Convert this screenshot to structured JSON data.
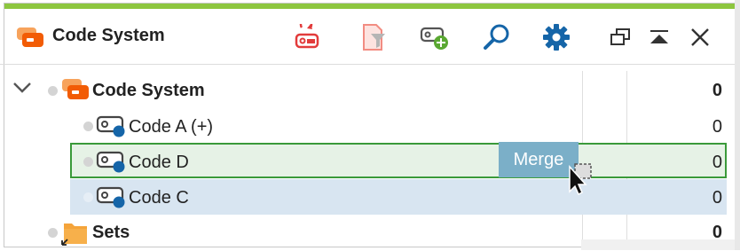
{
  "header": {
    "title": "Code System",
    "icons": [
      "code-system-icon",
      "remove-codes-icon",
      "filter-document-icon",
      "new-code-icon",
      "search-icon",
      "settings-icon",
      "undock-icon",
      "collapse-icon",
      "close-icon"
    ]
  },
  "tree": {
    "root": {
      "label": "Code System",
      "count": "0"
    },
    "items": [
      {
        "label": "Code A (+)",
        "count": "0"
      },
      {
        "label": "Code D",
        "count": "0"
      },
      {
        "label": "Code C",
        "count": "0"
      }
    ],
    "sets": {
      "label": "Sets",
      "count": "0"
    }
  },
  "drag": {
    "tooltip": "Merge"
  },
  "colors": {
    "accent_bar": "#8dc63f",
    "code_icon_orange": "#f25c05",
    "code_dot_blue": "#1565a8",
    "drop_target_border": "#3a9a3a",
    "drop_target_bg": "#e6f2e6",
    "selected_bg": "#d8e5f1",
    "merge_bg": "#7bafc8"
  }
}
